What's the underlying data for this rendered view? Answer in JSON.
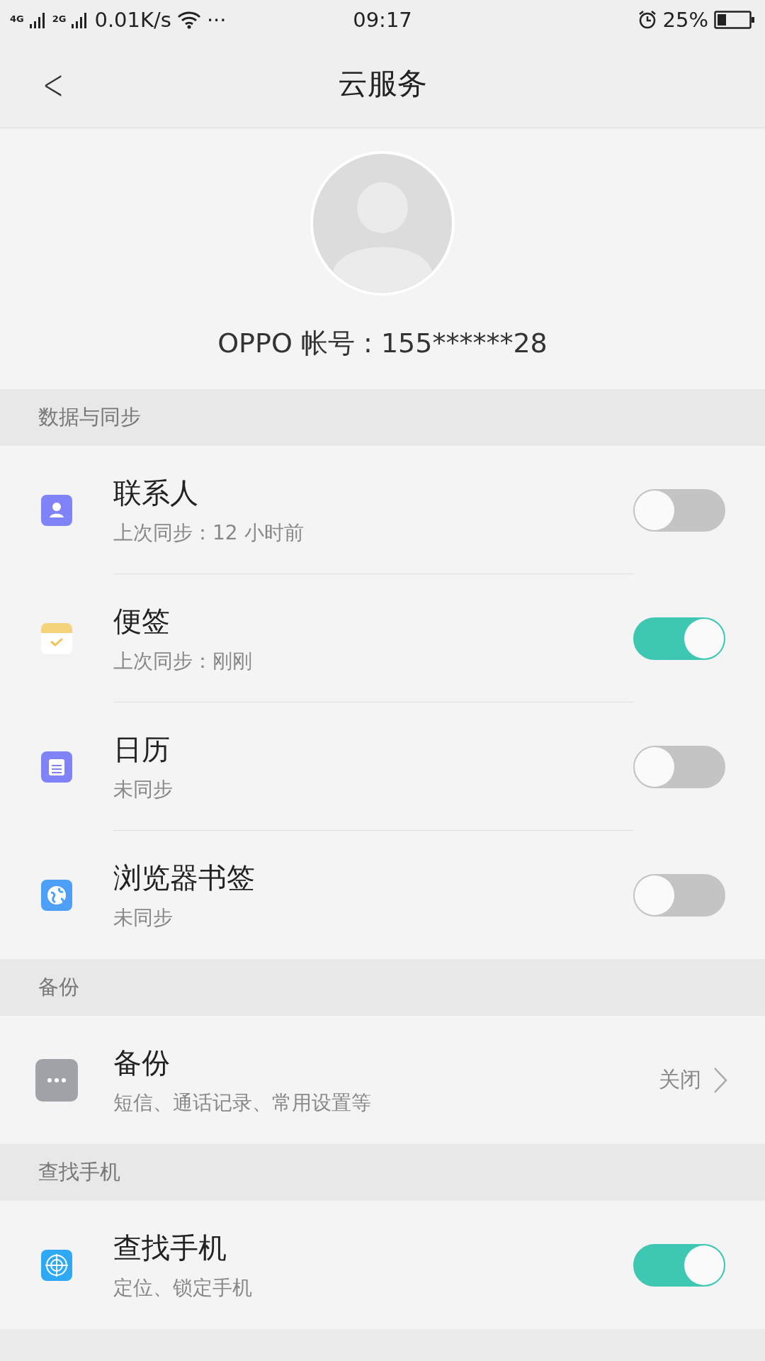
{
  "status_bar": {
    "net1": "4G",
    "net2": "2G",
    "speed": "0.01K/s",
    "more": "···",
    "time": "09:17",
    "battery": "25%"
  },
  "header": {
    "back": "<",
    "title": "云服务"
  },
  "profile": {
    "account": "OPPO 帐号 : 155******28"
  },
  "sections": [
    {
      "title": "数据与同步",
      "items": [
        {
          "kind": "toggle",
          "title": "联系人",
          "subtitle": "上次同步：12 小时前",
          "on": false
        },
        {
          "kind": "toggle",
          "title": "便签",
          "subtitle": "上次同步：刚刚",
          "on": true
        },
        {
          "kind": "toggle",
          "title": "日历",
          "subtitle": "未同步",
          "on": false
        },
        {
          "kind": "toggle",
          "title": "浏览器书签",
          "subtitle": "未同步",
          "on": false
        }
      ]
    },
    {
      "title": "备份",
      "items": [
        {
          "kind": "link",
          "title": "备份",
          "subtitle": "短信、通话记录、常用设置等",
          "value": "关闭"
        }
      ]
    },
    {
      "title": "查找手机",
      "items": [
        {
          "kind": "toggle",
          "title": "查找手机",
          "subtitle": "定位、锁定手机",
          "on": true
        }
      ]
    }
  ]
}
